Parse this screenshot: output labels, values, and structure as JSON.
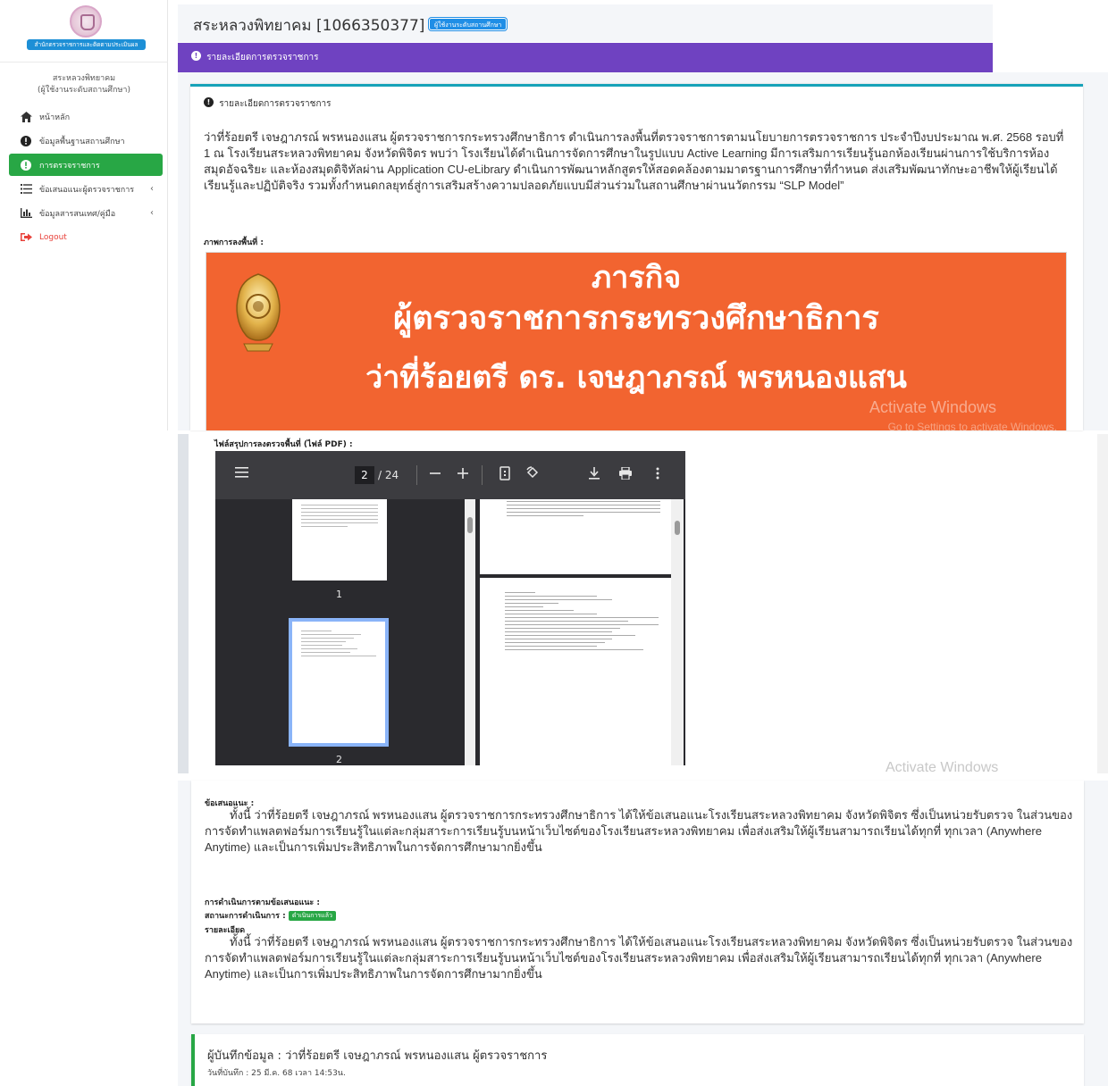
{
  "sidebar": {
    "logo_text": "สำนักตรวจราชการและติดตามประเมินผล",
    "user_name": "สระหลวงพิทยาคม",
    "user_role": "(ผู้ใช้งานระดับสถานศึกษา)",
    "items": [
      {
        "label": "หน้าหลัก",
        "icon": "home-icon"
      },
      {
        "label": "ข้อมูลพื้นฐานสถานศึกษา",
        "icon": "info-circle-icon"
      },
      {
        "label": "การตรวจราชการ",
        "icon": "info-circle-icon",
        "active": true
      },
      {
        "label": "ข้อเสนอแนะผู้ตรวจราชการ",
        "icon": "list-icon",
        "chevron": "‹"
      },
      {
        "label": "ข้อมูลสารสนเทศ/คู่มือ",
        "icon": "bar-chart-icon",
        "chevron": "‹"
      },
      {
        "label": "Logout",
        "icon": "sign-out-icon"
      }
    ]
  },
  "header": {
    "title": "สระหลวงพิทยาคม [1066350377]",
    "role_badge": "ผู้ใช้งานระดับสถานศึกษา",
    "section_bar": "รายละเอียดการตรวจราชการ"
  },
  "detail_card": {
    "title": "รายละเอียดการตรวจราชการ",
    "narrative": "ว่าที่ร้อยตรี เจษฎาภรณ์ พรหนองแสน ผู้ตรวจราชการกระทรวงศึกษาธิการ ดำเนินการลงพื้นที่ตรวจราชการตามนโยบายการตรวจราชการ ประจำปีงบประมาณ พ.ศ. 2568 รอบที่ 1 ณ โรงเรียนสระหลวงพิทยาคม จังหวัดพิจิตร พบว่า โรงเรียนได้ดำเนินการจัดการศึกษาในรูปแบบ Active Learning มีการเสริมการเรียนรู้นอกห้องเรียนผ่านการใช้บริการห้องสมุดอัจฉริยะ และห้องสมุดดิจิทัลผ่าน Application CU-eLibrary ดำเนินการพัฒนาหลักสูตรให้สอดคล้องตามมาตรฐานการศึกษาที่กำหนด ส่งเสริมพัฒนาทักษะอาชีพให้ผู้เรียนได้เรียนรู้และปฏิบัติจริง รวมทั้งกำหนดกลยุทธ์สู่การเสริมสร้างความปลอดภัยแบบมีส่วนร่วมในสถานศึกษาผ่านนวัตกรรม “SLP Model”",
    "photo_label": "ภาพการลงพื้นที่ :",
    "banner": {
      "line1": "ภารกิจ",
      "line2": "ผู้ตรวจราชการกระทรวงศึกษาธิการ",
      "line3": "ว่าที่ร้อยตรี ดร. เจษฎาภรณ์ พรหนองแสน",
      "watermark1": "Activate Windows",
      "watermark2": "Go to Settings to activate Windows."
    }
  },
  "pdf": {
    "label": "ไฟล์สรุปการลงตรวจพื้นที่ (ไฟล์ PDF) :",
    "current_page": "2",
    "total_pages": "/ 24",
    "thumbnails": [
      {
        "num": "1"
      },
      {
        "num": "2"
      }
    ],
    "watermark": "Activate Windows"
  },
  "recommendation": {
    "label": "ข้อเสนอแนะ :",
    "text": "ทั้งนี้ ว่าที่ร้อยตรี เจษฎาภรณ์ พรหนองแสน ผู้ตรวจราชการกระทรวงศึกษาธิการ ได้ให้ข้อเสนอแนะโรงเรียนสระหลวงพิทยาคม จังหวัดพิจิตร ซึ่งเป็นหน่วยรับตรวจ ในส่วนของการจัดทำแพลตฟอร์มการเรียนรู้ในแต่ละกลุ่มสาระการเรียนรู้บนหน้าเว็บไซต์ของโรงเรียนสระหลวงพิทยาคม เพื่อส่งเสริมให้ผู้เรียนสามารถเรียนได้ทุกที่ ทุกเวลา (Anywhere Anytime) และเป็นการเพิ่มประสิทธิภาพในการจัดการศึกษามากยิ่งขึ้น"
  },
  "followup": {
    "label": "การดำเนินการตามข้อเสนอแนะ :",
    "status_label": "สถานะการดำเนินการ :",
    "status_badge": "ดำเนินการแล้ว",
    "detail_label": "รายละเอียด",
    "text": "ทั้งนี้ ว่าที่ร้อยตรี เจษฎาภรณ์ พรหนองแสน ผู้ตรวจราชการกระทรวงศึกษาธิการ ได้ให้ข้อเสนอแนะโรงเรียนสระหลวงพิทยาคม จังหวัดพิจิตร ซึ่งเป็นหน่วยรับตรวจ ในส่วนของการจัดทำแพลตฟอร์มการเรียนรู้ในแต่ละกลุ่มสาระการเรียนรู้บนหน้าเว็บไซต์ของโรงเรียนสระหลวงพิทยาคม เพื่อส่งเสริมให้ผู้เรียนสามารถเรียนได้ทุกที่ ทุกเวลา (Anywhere Anytime) และเป็นการเพิ่มประสิทธิภาพในการจัดการศึกษามากยิ่งขึ้น"
  },
  "footer": {
    "recorder": "ผู้บันทึกข้อมูล : ว่าที่ร้อยตรี เจษฎาภรณ์ พรหนองแสน  ผู้ตรวจราชการ",
    "recorded_date": "วันที่บันทึก : 25 มี.ค. 68 เวลา 14:53น."
  },
  "colors": {
    "purple": "#6f42c1",
    "green": "#28a745",
    "blue": "#1f8ee6",
    "banner_orange": "#f26430",
    "teal": "#17a2b8"
  }
}
